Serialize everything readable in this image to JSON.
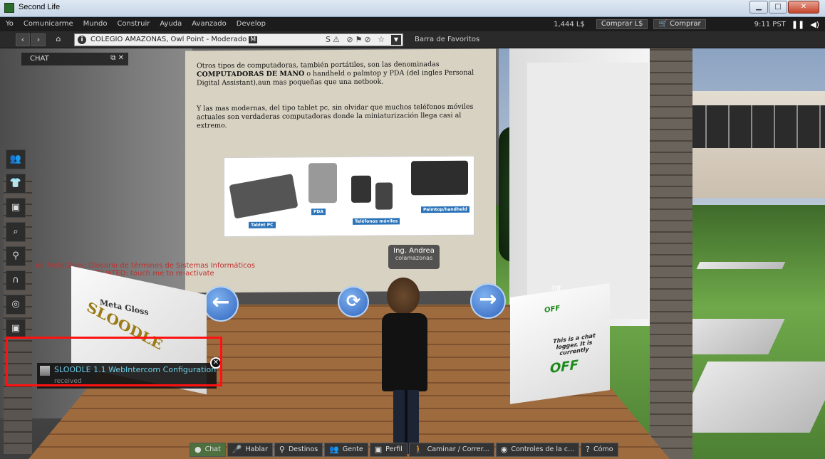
{
  "window": {
    "title": "Second Life"
  },
  "menu": {
    "items": [
      "Yo",
      "Comunicarme",
      "Mundo",
      "Construir",
      "Ayuda",
      "Avanzado",
      "Develop"
    ],
    "balance": "1,444 L$",
    "buy_currency": "Comprar L$",
    "buy": "Comprar",
    "time": "9:11 PST"
  },
  "nav": {
    "location": "COLEGIO AMAZONAS, Owl Point - Moderado",
    "badge": "M",
    "favorites": "Barra de Favoritos"
  },
  "chat_floater": {
    "title": "CHAT"
  },
  "board": {
    "para1_a": "Otros tipos de computadoras, también portátiles, son las denominadas",
    "para1_b": "COMPUTADORAS DE MANO",
    "para1_c": "o handheld o palmtop y PDA (del ingles Personal Digital Assistant),aun mas poqueñas que una netbook.",
    "para2": "Y las mas modernas, del tipo tablet pc, sin olvidar que muchos teléfonos móviles actuales son verdaderas computadoras donde la miniaturización llega casi al extremo.",
    "labels": [
      "Tablet PC",
      "PDA",
      "Teléfonos móviles",
      "Palmtop/handheld"
    ]
  },
  "avatar": {
    "name": "Ing. Andrea",
    "username": "colamazonas"
  },
  "left_cube": {
    "floating_text_1": "de MetaGloss: Glosario de términos de Sistemas Informáticos",
    "floating_text_2": "DEACTIVATED: touch me to re-activate",
    "label_a": "Meta Gloss",
    "label_b": "SLOODLE"
  },
  "right_cube": {
    "float_label": "Off",
    "top_text": "OFF",
    "message": "This is a chat logger. It is currently",
    "status": "OFF"
  },
  "notification": {
    "title": "SLOODLE 1.1 WebIntercom Configuration",
    "subtitle": "received"
  },
  "bottom_bar": {
    "buttons": [
      "Chat",
      "Hablar",
      "Destinos",
      "Gente",
      "Perfil",
      "Caminar / Correr...",
      "Controles de la c...",
      "Cómo"
    ]
  },
  "icons": {
    "left_toolbar": [
      "people-icon",
      "shirt-icon",
      "inventory-icon",
      "search-icon",
      "map-pin-icon",
      "headphones-icon",
      "radar-icon",
      "camera-icon"
    ]
  }
}
